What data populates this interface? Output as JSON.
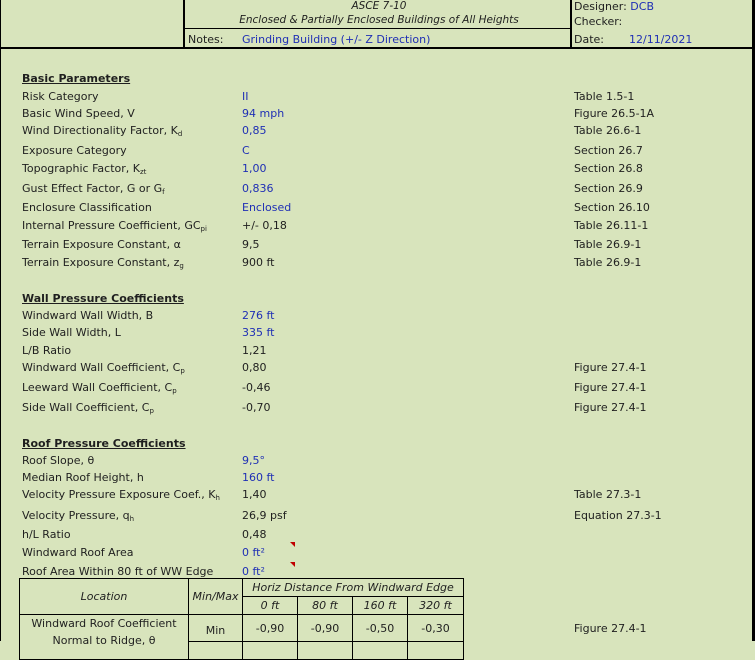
{
  "header": {
    "code": "ASCE 7-10",
    "subtitle": "Enclosed & Partially Enclosed Buildings of All Heights",
    "notes_label": "Notes:",
    "notes_value": "Grinding Building (+/- Z Direction)",
    "designer_label": "Designer:",
    "designer_value": "DCB",
    "checker_label": "Checker:",
    "checker_value": "",
    "date_label": "Date:",
    "date_value": "12/11/2021"
  },
  "basic": {
    "title": "Basic Parameters",
    "rows": [
      {
        "label": "Risk Category",
        "sub": "",
        "value": "II",
        "ref": "Table 1.5-1",
        "input": true
      },
      {
        "label": "Basic Wind Speed, V",
        "sub": "",
        "value": "94 mph",
        "ref": "Figure 26.5-1A",
        "input": true
      },
      {
        "label": "Wind Directionality Factor, K",
        "sub": "d",
        "value": "0,85",
        "ref": "Table 26.6-1",
        "input": true
      },
      {
        "label": "Exposure Category",
        "sub": "",
        "value": "C",
        "ref": "Section 26.7",
        "input": true
      },
      {
        "label": "Topographic Factor, K",
        "sub": "zt",
        "value": "1,00",
        "ref": "Section 26.8",
        "input": true
      },
      {
        "label": "Gust Effect Factor, G or G",
        "sub": "f",
        "value": "0,836",
        "ref": "Section 26.9",
        "input": true
      },
      {
        "label": "Enclosure Classification",
        "sub": "",
        "value": "Enclosed",
        "ref": "Section 26.10",
        "input": true
      },
      {
        "label": "Internal Pressure Coefficient, GC",
        "sub": "pi",
        "value": "+/- 0,18",
        "ref": "Table 26.11-1",
        "input": false
      },
      {
        "label": "Terrain Exposure Constant, α",
        "sub": "",
        "value": "9,5",
        "ref": "Table 26.9-1",
        "input": false
      },
      {
        "label": "Terrain Exposure Constant, z",
        "sub": "g",
        "value": "900 ft",
        "ref": "Table 26.9-1",
        "input": false
      }
    ]
  },
  "wall": {
    "title": "Wall Pressure Coefficients",
    "rows": [
      {
        "label": "Windward Wall Width, B",
        "sub": "",
        "value": "276 ft",
        "ref": "",
        "input": true
      },
      {
        "label": "Side Wall Width, L",
        "sub": "",
        "value": "335 ft",
        "ref": "",
        "input": true
      },
      {
        "label": "L/B Ratio",
        "sub": "",
        "value": "1,21",
        "ref": "",
        "input": false
      },
      {
        "label": "Windward Wall Coefficient, C",
        "sub": "p",
        "value": "0,80",
        "ref": "Figure 27.4-1",
        "input": false
      },
      {
        "label": "Leeward Wall Coefficient, C",
        "sub": "p",
        "value": "-0,46",
        "ref": "Figure 27.4-1",
        "input": false
      },
      {
        "label": "Side Wall Coefficient, C",
        "sub": "p",
        "value": "-0,70",
        "ref": "Figure 27.4-1",
        "input": false
      }
    ]
  },
  "roof": {
    "title": "Roof Pressure Coefficients",
    "rows": [
      {
        "label": "Roof Slope, θ",
        "sub": "",
        "value": "9,5°",
        "ref": "",
        "input": true
      },
      {
        "label": "Median Roof Height, h",
        "sub": "",
        "value": "160 ft",
        "ref": "",
        "input": true
      },
      {
        "label": "Velocity Pressure Exposure Coef., K",
        "sub": "h",
        "value": "1,40",
        "ref": "Table 27.3-1",
        "input": false
      },
      {
        "label": "Velocity Pressure, q",
        "sub": "h",
        "value": "26,9 psf",
        "ref": "Equation 27.3-1",
        "input": false
      },
      {
        "label": "h/L Ratio",
        "sub": "",
        "value": "0,48",
        "ref": "",
        "input": false
      },
      {
        "label": "Windward Roof Area",
        "sub": "",
        "value": "0 ft²",
        "ref": "",
        "input": true
      },
      {
        "label": "Roof Area Within 80 ft of WW Edge",
        "sub": "",
        "value": "0 ft²",
        "ref": "",
        "input": true
      }
    ]
  },
  "coef_table": {
    "location_header": "Location",
    "minmax_header": "Min/Max",
    "distance_header": "Horiz Distance From Windward Edge",
    "distances": [
      "0 ft",
      "80 ft",
      "160 ft",
      "320 ft"
    ],
    "rows": [
      {
        "location": "Windward Roof Coefficient",
        "location2": "Normal to Ridge, θ",
        "minmax": "Min",
        "values": [
          "-0,90",
          "-0,90",
          "-0,50",
          "-0,30"
        ],
        "ref": "Figure 27.4-1"
      }
    ]
  }
}
